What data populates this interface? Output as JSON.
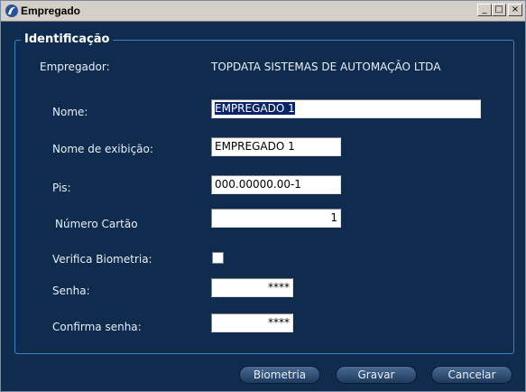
{
  "window": {
    "title": "Empregado"
  },
  "titlebar": {
    "min": "_",
    "max": "□",
    "close": "×"
  },
  "group": {
    "title": "Identificação"
  },
  "form": {
    "empregador_label": "Empregador:",
    "empregador_value": "TOPDATA SISTEMAS DE AUTOMAÇÃO LTDA",
    "nome_label": "Nome:",
    "nome_value": "EMPREGADO 1",
    "exibicao_label": "Nome de exibição:",
    "exibicao_value": "EMPREGADO 1",
    "pis_label": "Pis:",
    "pis_value": "000.00000.00-1",
    "cartao_label": "Número Cartão",
    "cartao_value": "1",
    "biometria_label": "Verifica Biometria:",
    "biometria_checked": false,
    "senha_label": "Senha:",
    "senha_value": "****",
    "confirma_label": "Confirma senha:",
    "confirma_value": "****"
  },
  "buttons": {
    "biometria": "Biometria",
    "gravar": "Gravar",
    "cancelar": "Cancelar"
  }
}
